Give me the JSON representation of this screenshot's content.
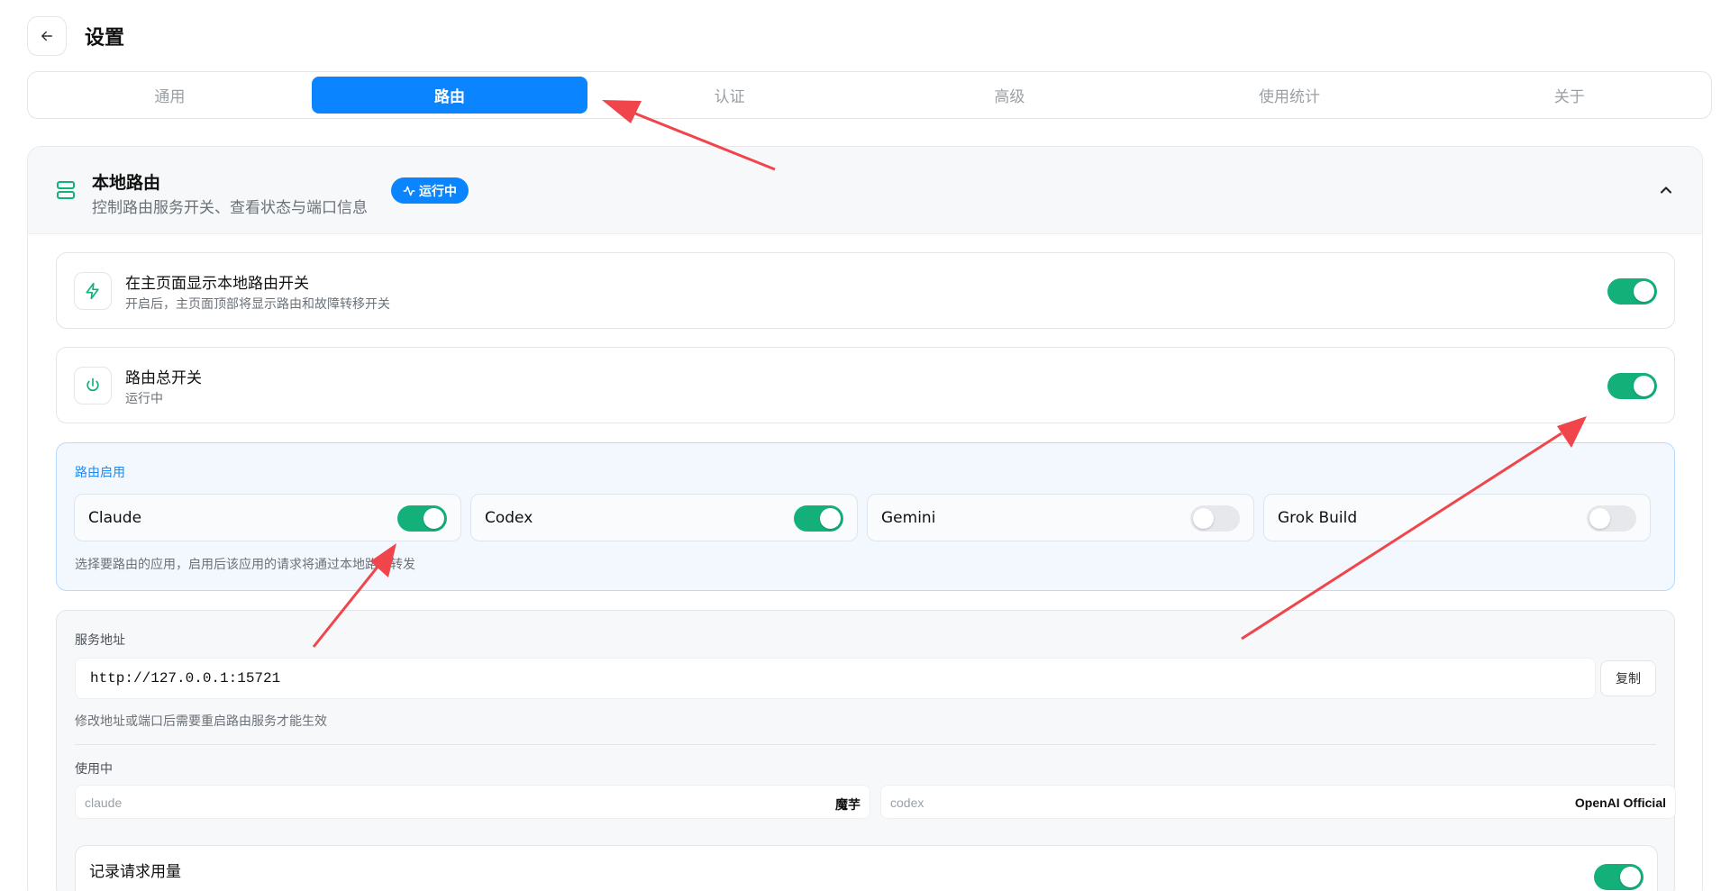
{
  "header": {
    "title": "设置"
  },
  "tabs": [
    {
      "label": "通用",
      "active": false
    },
    {
      "label": "路由",
      "active": true
    },
    {
      "label": "认证",
      "active": false
    },
    {
      "label": "高级",
      "active": false
    },
    {
      "label": "使用统计",
      "active": false
    },
    {
      "label": "关于",
      "active": false
    }
  ],
  "panel": {
    "title": "本地路由",
    "subtitle": "控制路由服务开关、查看状态与端口信息",
    "status_badge": "运行中",
    "accent_color": "#0a84ff",
    "toggle_on_color": "#13b07a"
  },
  "rows": [
    {
      "title": "在主页面显示本地路由开关",
      "subtitle": "开启后，主页面顶部将显示路由和故障转移开关",
      "icon": "bolt-icon",
      "enabled": true
    },
    {
      "title": "路由总开关",
      "subtitle": "运行中",
      "icon": "power-icon",
      "enabled": true
    }
  ],
  "apps": {
    "label": "路由启用",
    "items": [
      {
        "name": "Claude",
        "enabled": true
      },
      {
        "name": "Codex",
        "enabled": true
      },
      {
        "name": "Gemini",
        "enabled": false
      },
      {
        "name": "Grok Build",
        "enabled": false
      }
    ],
    "hint": "选择要路由的应用，启用后该应用的请求将通过本地路由转发"
  },
  "service": {
    "label": "服务地址",
    "address": "http://127.0.0.1:15721",
    "copy_label": "复制",
    "hint": "修改地址或端口后需要重启路由服务才能生效",
    "in_use_label": "使用中",
    "in_use": [
      {
        "key": "claude",
        "value": "魔芋"
      },
      {
        "key": "codex",
        "value": "OpenAI Official"
      }
    ],
    "record_title": "记录请求用量",
    "record_enabled": true
  },
  "annotation_color": "#f0454b"
}
